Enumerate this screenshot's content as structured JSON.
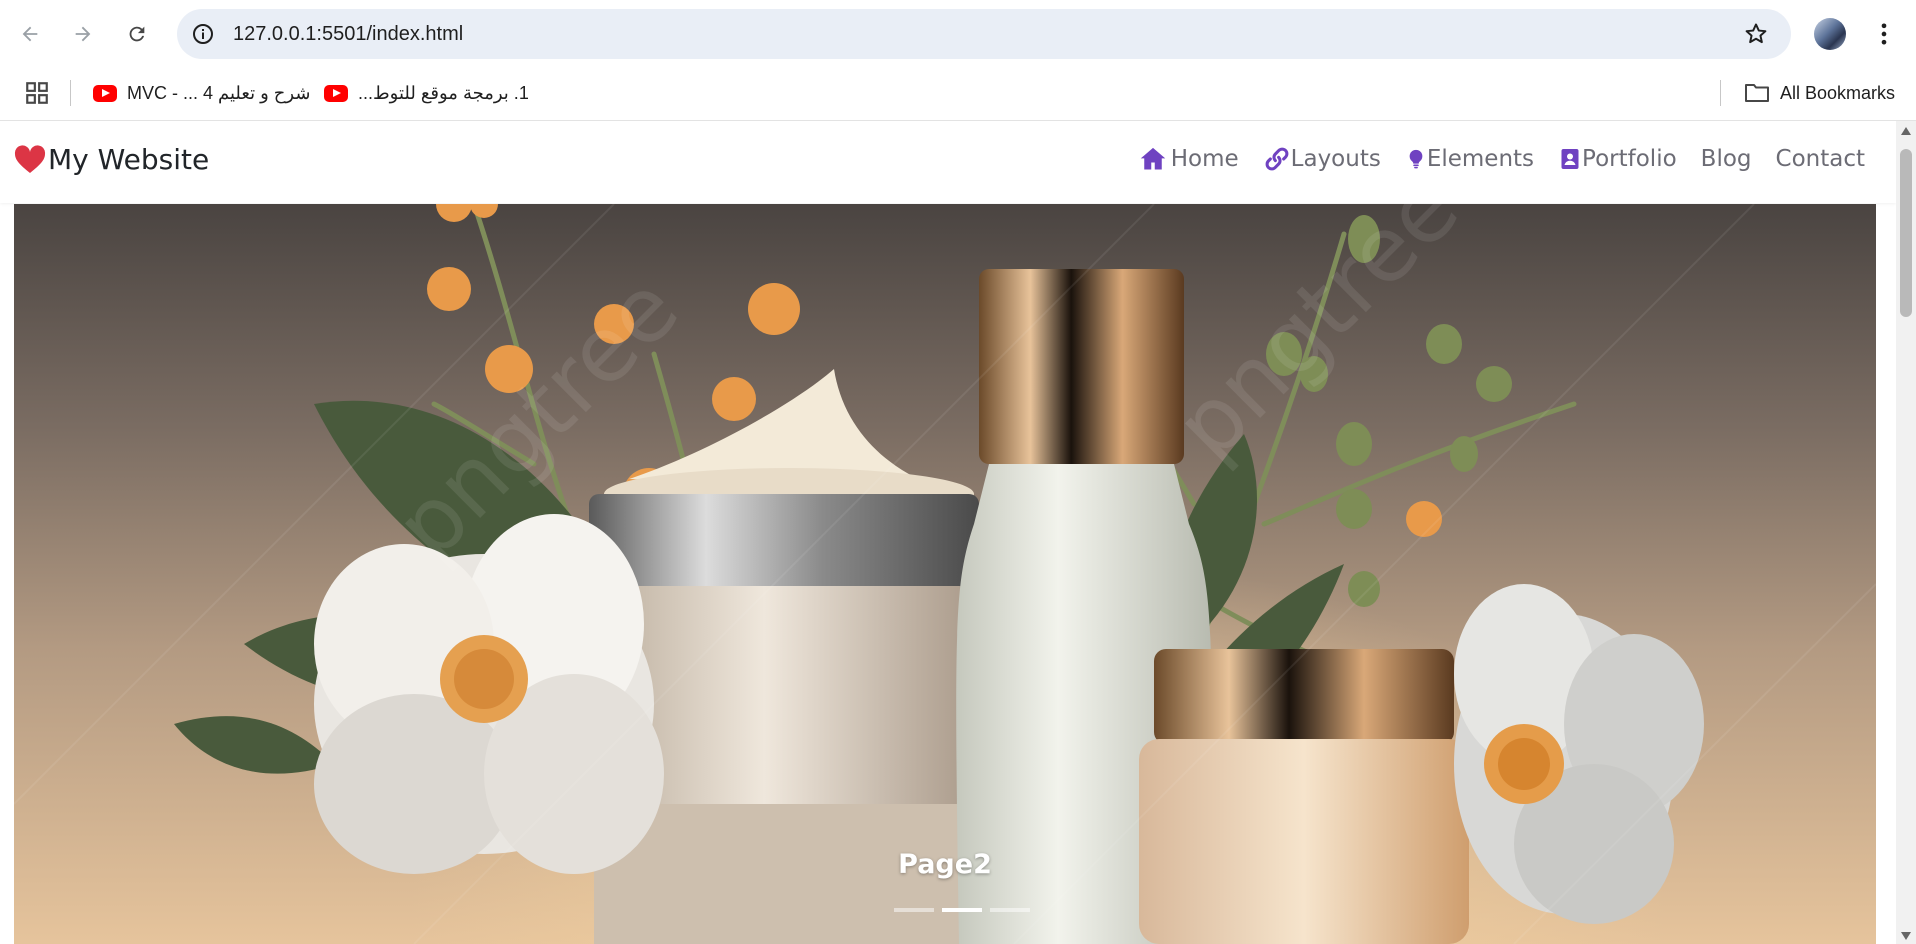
{
  "browser": {
    "url": "127.0.0.1:5501/index.html",
    "bookmarks": [
      {
        "label": "شرح و تعليم 4 ... - MVC",
        "icon": "youtube-icon"
      },
      {
        "label": "1. برمجة موقع للتوط...",
        "icon": "youtube-icon"
      }
    ],
    "all_bookmarks_label": "All Bookmarks"
  },
  "site": {
    "brand": "My Website",
    "brand_icon": "heart-icon",
    "brand_color": "#dc3545",
    "accent_color": "#6f42c1",
    "nav": [
      {
        "label": "Home",
        "icon": "house-icon"
      },
      {
        "label": "Layouts",
        "icon": "link-icon"
      },
      {
        "label": "Elements",
        "icon": "lightbulb-icon"
      },
      {
        "label": "Portfolio",
        "icon": "person-badge-icon"
      },
      {
        "label": "Blog",
        "icon": ""
      },
      {
        "label": "Contact",
        "icon": ""
      }
    ]
  },
  "carousel": {
    "caption": "Page2",
    "watermark": "pngtree",
    "slide_count": 3,
    "active_index": 1
  }
}
